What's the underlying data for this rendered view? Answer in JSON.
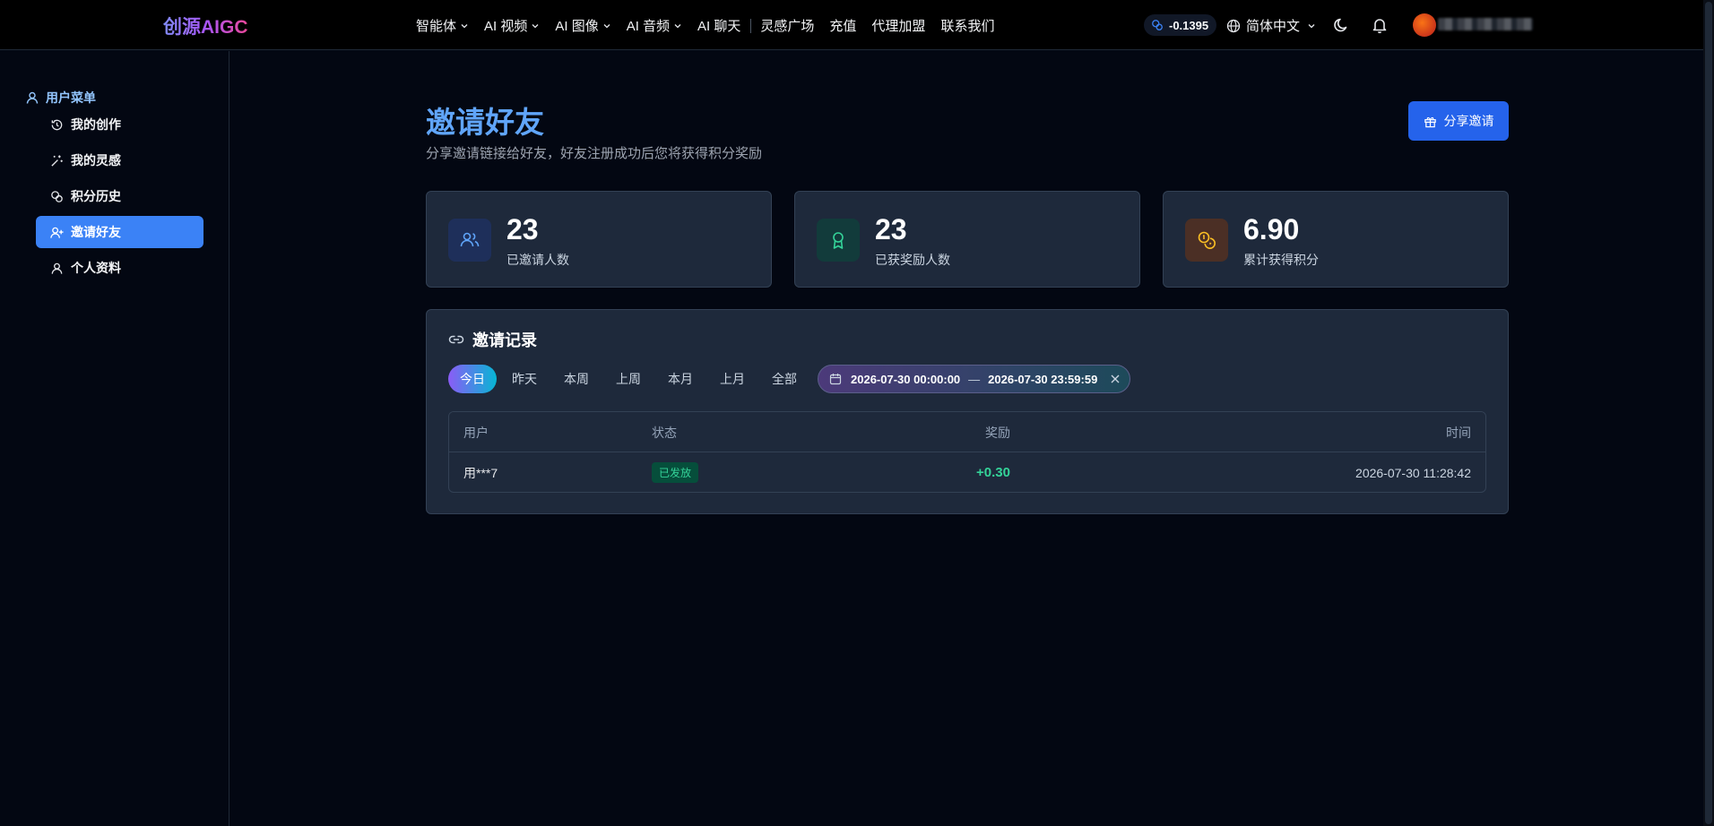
{
  "header": {
    "logo": "创源AIGC",
    "nav": [
      {
        "label": "智能体",
        "dropdown": true
      },
      {
        "label": "AI 视频",
        "dropdown": true
      },
      {
        "label": "AI 图像",
        "dropdown": true
      },
      {
        "label": "AI 音频",
        "dropdown": true
      },
      {
        "label": "AI 聊天",
        "dropdown": false
      },
      {
        "label": "灵感广场",
        "dropdown": false
      },
      {
        "label": "充值",
        "dropdown": false
      },
      {
        "label": "代理加盟",
        "dropdown": false
      },
      {
        "label": "联系我们",
        "dropdown": false
      }
    ],
    "balance": "-0.1395",
    "language": "简体中文",
    "icons": {
      "balance": "coins-icon",
      "language": "globe-icon",
      "theme": "moon-icon",
      "notifications": "bell-icon"
    }
  },
  "sidebar": {
    "title": "用户菜单",
    "items": [
      {
        "label": "我的创作",
        "icon": "history-icon",
        "active": false
      },
      {
        "label": "我的灵感",
        "icon": "sparkles-icon",
        "active": false
      },
      {
        "label": "积分历史",
        "icon": "coins-icon",
        "active": false
      },
      {
        "label": "邀请好友",
        "icon": "user-plus-icon",
        "active": true
      },
      {
        "label": "个人资料",
        "icon": "user-icon",
        "active": false
      }
    ]
  },
  "main": {
    "title": "邀请好友",
    "subtitle": "分享邀请链接给好友，好友注册成功后您将获得积分奖励",
    "share_button": "分享邀请",
    "stats": [
      {
        "value": "23",
        "label": "已邀请人数",
        "icon": "users-icon",
        "color": "#60a5fa"
      },
      {
        "value": "23",
        "label": "已获奖励人数",
        "icon": "award-icon",
        "color": "#34d399"
      },
      {
        "value": "6.90",
        "label": "累计获得积分",
        "icon": "coins-icon",
        "color": "#fbbf24"
      }
    ],
    "records": {
      "title": "邀请记录",
      "filters": [
        "今日",
        "昨天",
        "本周",
        "上周",
        "本月",
        "上月",
        "全部"
      ],
      "active_filter": "今日",
      "date_start": "2026-07-30 00:00:00",
      "date_separator": "—",
      "date_end": "2026-07-30 23:59:59",
      "columns": [
        "用户",
        "状态",
        "奖励",
        "时间"
      ],
      "rows": [
        {
          "user": "用***7",
          "status": "已发放",
          "reward": "+0.30",
          "time": "2026-07-30 11:28:42"
        }
      ]
    }
  }
}
